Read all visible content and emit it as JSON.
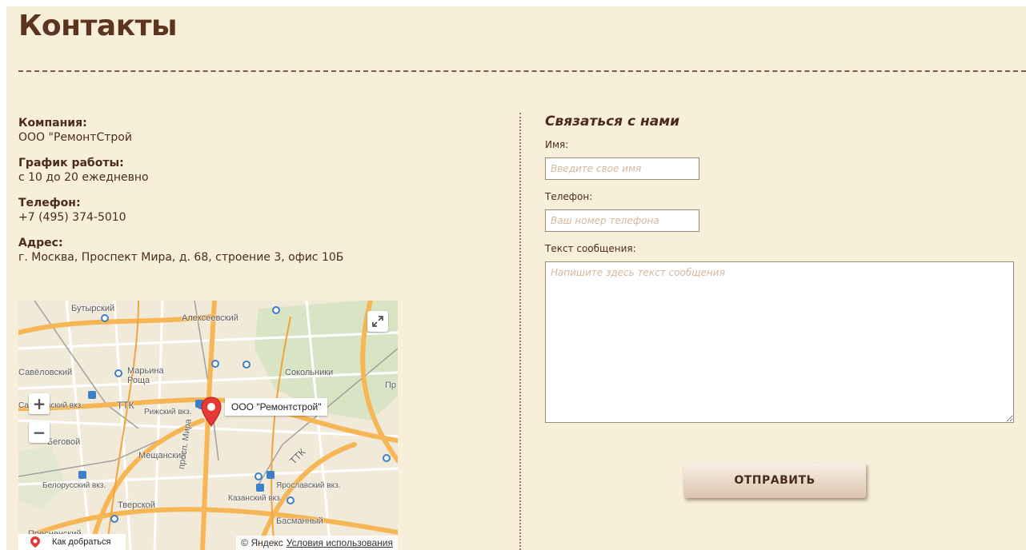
{
  "page": {
    "title": "Контакты"
  },
  "info": {
    "company_label": "Компания:",
    "company_value": "ООО \"РемонтСтрой",
    "hours_label": "График работы:",
    "hours_value": "с 10 до 20 ежедневно",
    "phone_label": "Телефон:",
    "phone_value": "+7 (495) 374-5010",
    "address_label": "Адрес:",
    "address_value": "г. Москва, Проспект Мира, д. 68, строение 3, офис 10Б"
  },
  "map": {
    "pin_label": "ООО \"Ремонтстрой\"",
    "zoom_in": "+",
    "zoom_out": "−",
    "route_label": "Как добраться",
    "copyright": "© Яндекс",
    "terms_link": "Условия использования",
    "place_labels": {
      "butyrsky": "Бутырский",
      "alekseevsky": "Алексеевский",
      "savelovsky": "Савёловский",
      "marina_roscha": "Марьина Роща",
      "sokolniki": "Сокольники",
      "pr": "Пр",
      "ttk1": "ТТК",
      "savelovsky_vkz": "Савёловский вкз.",
      "rizhsky_vkz": "Рижский вкз.",
      "begovoy": "Беговой",
      "meschansky": "Мещанский",
      "prosp_mira": "просп. Мира",
      "ttk2": "ТТК",
      "belorussky_vkz": "Белорусский вкз.",
      "yaroslavsky_vkz": "Ярославский вкз.",
      "kazansky_vkz": "Казанский вкз.",
      "tverskoy": "Тверской",
      "basmanny": "Басманный",
      "presnensky": "Пресненский"
    },
    "colors": {
      "major_road": "#f6b656",
      "park": "#d8e4c4",
      "rail": "#a0a0a0",
      "metro": "#3d7fc8",
      "pin": "#e53935"
    }
  },
  "form": {
    "title": "Связаться с нами",
    "name_label": "Имя:",
    "name_placeholder": "Введите свое имя",
    "name_value": "",
    "phone_label": "Телефон:",
    "phone_placeholder": "Ваш номер телефона",
    "phone_value": "",
    "message_label": "Текст сообщения:",
    "message_placeholder": "Напишите здесь текст сообщения",
    "message_value": "",
    "submit_label": "ОТПРАВИТЬ"
  }
}
